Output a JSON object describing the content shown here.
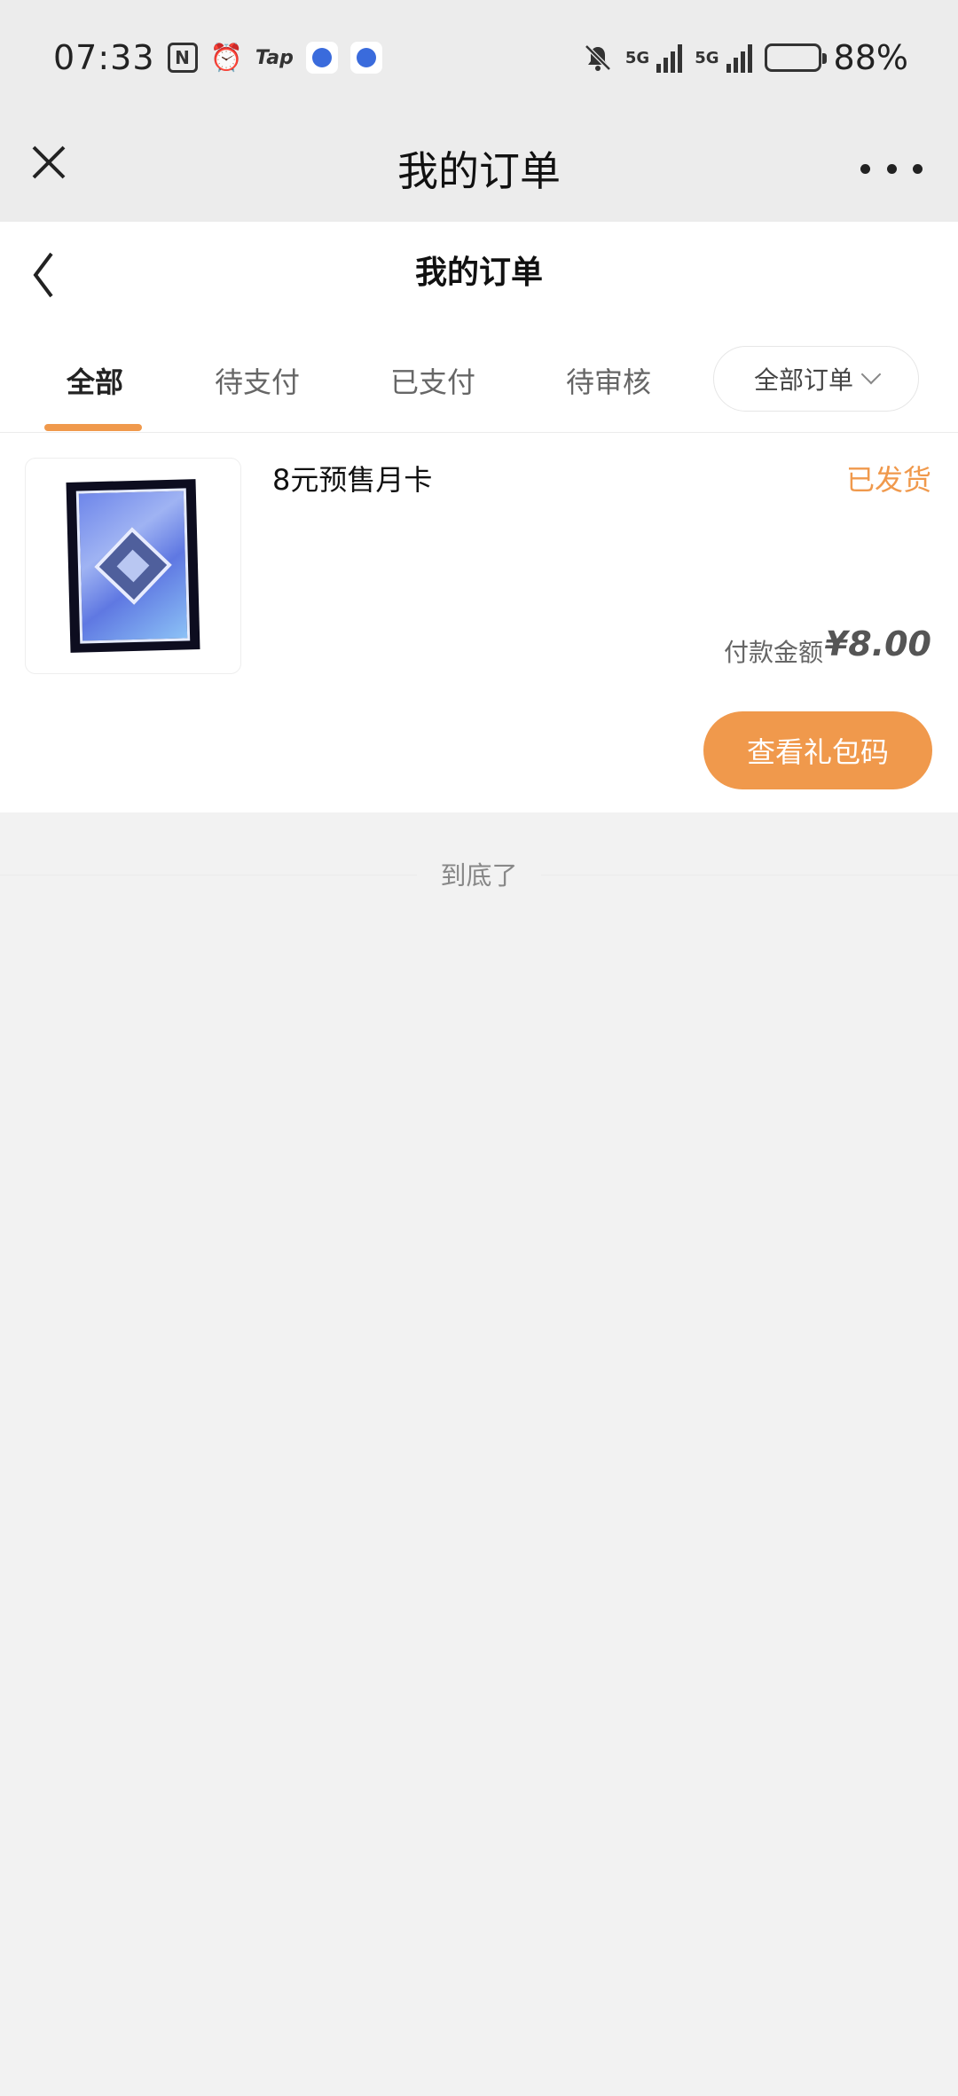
{
  "status_bar": {
    "time": "07:33",
    "tap_label": "Tap",
    "network_1": "5G",
    "network_2": "5G",
    "battery_percent": "88%",
    "battery_level": 0.88,
    "icons": [
      "nfc-icon",
      "alarm-icon",
      "tap-app-icon",
      "baidu-icon",
      "baidu-icon",
      "mute-bell-icon",
      "signal-icon",
      "signal-icon",
      "battery-icon"
    ]
  },
  "top_nav": {
    "title": "我的订单",
    "close_icon": "close-icon",
    "more_icon": "more-icon"
  },
  "page_header": {
    "title": "我的订单",
    "back_icon": "chevron-left-icon"
  },
  "tabs": {
    "items": [
      {
        "label": "全部",
        "active": true
      },
      {
        "label": "待支付",
        "active": false
      },
      {
        "label": "已支付",
        "active": false
      },
      {
        "label": "待审核",
        "active": false
      }
    ],
    "filter_label": "全部订单",
    "filter_icon": "chevron-down-icon"
  },
  "order": {
    "product_name": "8元预售月卡",
    "status": "已发货",
    "amount_label": "付款金额",
    "amount_value": "¥8.00",
    "action_label": "查看礼包码"
  },
  "list_end_text": "到底了",
  "colors": {
    "accent": "#f0994c",
    "background": "#f2f2f2",
    "nav_background": "#ececec"
  }
}
